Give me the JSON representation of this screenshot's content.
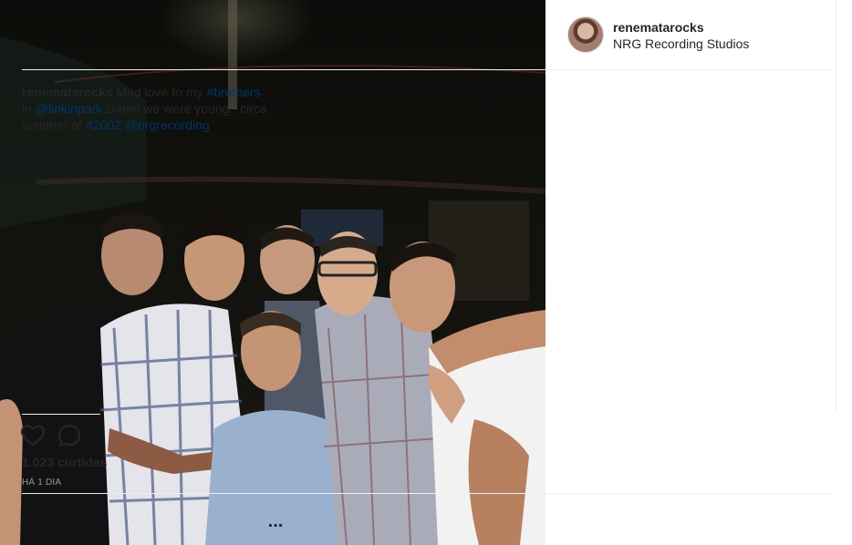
{
  "post": {
    "username": "renematarocks",
    "location": "NRG Recording Studios",
    "caption": {
      "username": "renematarocks",
      "segments": [
        {
          "text": " Mad love to my ",
          "link": false
        },
        {
          "text": "#brothers",
          "link": true
        },
        {
          "text": " in ",
          "link": false
        },
        {
          "text": "@linkinpark",
          "link": true
        },
        {
          "text": " Damn we were young.. circa summer of ",
          "link": false
        },
        {
          "text": "#2002",
          "link": true
        },
        {
          "text": " ",
          "link": false
        },
        {
          "text": "@nrgrecording",
          "link": true
        }
      ]
    },
    "likes_text": "1.023 curtidas",
    "time_text": "HÁ 1 DIA",
    "more_text": "..."
  },
  "icons": {
    "like": "heart-icon",
    "comment": "comment-icon",
    "more": "more-options-icon"
  },
  "colors": {
    "link": "#003569",
    "text": "#262626",
    "muted": "#999999",
    "divider": "#efefef"
  }
}
